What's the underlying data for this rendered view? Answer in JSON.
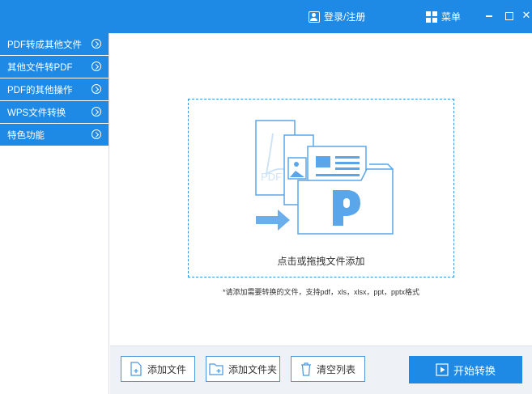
{
  "titlebar": {
    "login_label": "登录/注册",
    "menu_label": "菜单",
    "close_glyph": "✕"
  },
  "sidebar": {
    "items": [
      {
        "label": "PDF转成其他文件"
      },
      {
        "label": "其他文件转PDF"
      },
      {
        "label": "PDF的其他操作"
      },
      {
        "label": "WPS文件转换"
      },
      {
        "label": "特色功能"
      }
    ]
  },
  "main": {
    "dropzone_text": "点击或拖拽文件添加",
    "hint": "*请添加需要转换的文件，支持pdf，xls，xlsx，ppt，pptx格式",
    "illustration_doc_label": "PDF"
  },
  "bottom": {
    "add_file": "添加文件",
    "add_folder": "添加文件夹",
    "clear_list": "清空列表",
    "start": "开始转换"
  },
  "colors": {
    "accent": "#1e8ae6",
    "illustration_blue": "#5aa6ea"
  }
}
